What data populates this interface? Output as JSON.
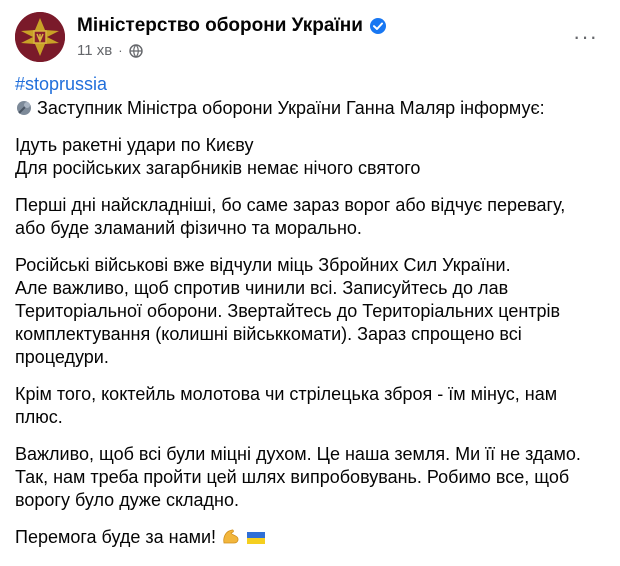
{
  "page": {
    "name": "Міністерство оборони України",
    "time": "11 хв",
    "time_sep": "·",
    "more_label": "···",
    "icons": {
      "avatar": "ministry-emblem",
      "verified": "verified-badge-icon",
      "audience": "globe-icon",
      "lead": "pin-emoji",
      "muscle": "flexed-biceps-emoji",
      "flag": "ukraine-flag-emoji"
    },
    "colors": {
      "hashtag": "#216fdb",
      "verified": "#1877f2",
      "avatar_bg": "#7a1a2a",
      "meta": "#65676b"
    }
  },
  "post": {
    "hashtag": "#stoprussia",
    "lead": "Заступник Міністра оборони України Ганна Маляр інформує:",
    "p1": [
      "Ідуть ракетні удари по Києву",
      "Для російських загарбників немає нічого святого"
    ],
    "p2": [
      "Перші дні найскладніші, бо саме зараз ворог або відчує перевагу,",
      "або буде зламаний фізично та морально."
    ],
    "p3": [
      "Російські військові вже відчули міць Збройних Сил України.",
      "Але важливо, щоб спротив чинили всі. Записуйтесь до лав",
      "Територіальної оборони. Звертайтесь до Територіальних центрів",
      "комплектування (колишні військкомати). Зараз спрощено всі",
      "процедури."
    ],
    "p4": [
      "Крім того, коктейль молотова чи стрілецька зброя - їм мінус, нам",
      "плюс."
    ],
    "p5": [
      "Важливо, щоб всі були міцні духом. Це наша земля. Ми її не здамо.",
      "Так, нам треба пройти цей шлях випробовувань. Робимо все, щоб",
      "ворогу було дуже складно."
    ],
    "p6": "Перемога буде за нами!"
  }
}
